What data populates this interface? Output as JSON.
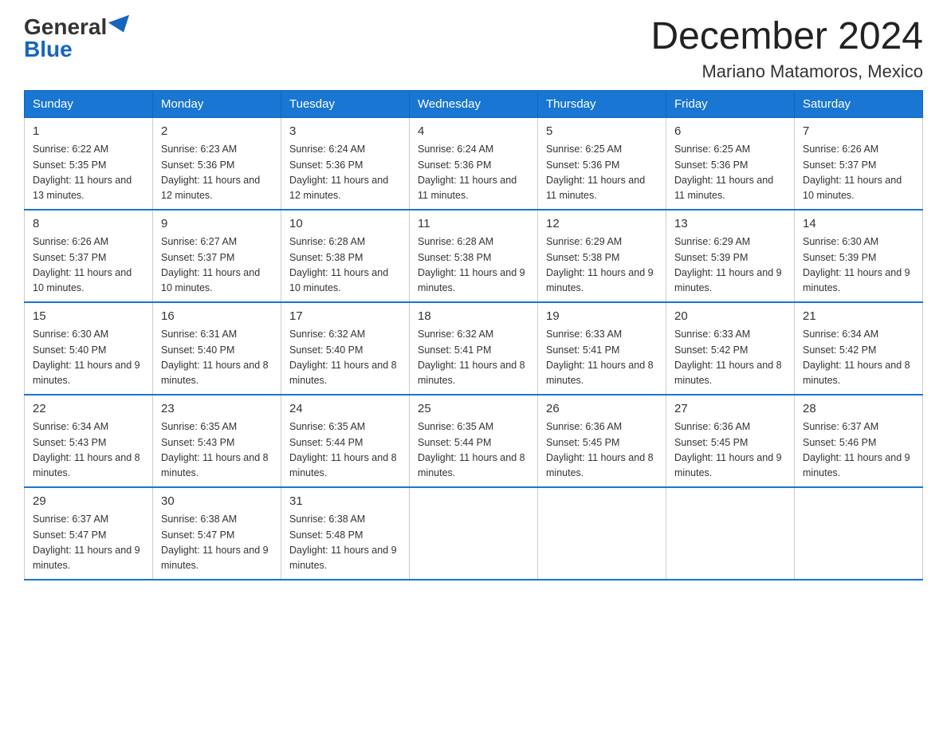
{
  "logo": {
    "general": "General",
    "blue": "Blue"
  },
  "title": {
    "month": "December 2024",
    "location": "Mariano Matamoros, Mexico"
  },
  "header_days": [
    "Sunday",
    "Monday",
    "Tuesday",
    "Wednesday",
    "Thursday",
    "Friday",
    "Saturday"
  ],
  "weeks": [
    [
      {
        "day": "1",
        "sunrise": "6:22 AM",
        "sunset": "5:35 PM",
        "daylight": "11 hours and 13 minutes."
      },
      {
        "day": "2",
        "sunrise": "6:23 AM",
        "sunset": "5:36 PM",
        "daylight": "11 hours and 12 minutes."
      },
      {
        "day": "3",
        "sunrise": "6:24 AM",
        "sunset": "5:36 PM",
        "daylight": "11 hours and 12 minutes."
      },
      {
        "day": "4",
        "sunrise": "6:24 AM",
        "sunset": "5:36 PM",
        "daylight": "11 hours and 11 minutes."
      },
      {
        "day": "5",
        "sunrise": "6:25 AM",
        "sunset": "5:36 PM",
        "daylight": "11 hours and 11 minutes."
      },
      {
        "day": "6",
        "sunrise": "6:25 AM",
        "sunset": "5:36 PM",
        "daylight": "11 hours and 11 minutes."
      },
      {
        "day": "7",
        "sunrise": "6:26 AM",
        "sunset": "5:37 PM",
        "daylight": "11 hours and 10 minutes."
      }
    ],
    [
      {
        "day": "8",
        "sunrise": "6:26 AM",
        "sunset": "5:37 PM",
        "daylight": "11 hours and 10 minutes."
      },
      {
        "day": "9",
        "sunrise": "6:27 AM",
        "sunset": "5:37 PM",
        "daylight": "11 hours and 10 minutes."
      },
      {
        "day": "10",
        "sunrise": "6:28 AM",
        "sunset": "5:38 PM",
        "daylight": "11 hours and 10 minutes."
      },
      {
        "day": "11",
        "sunrise": "6:28 AM",
        "sunset": "5:38 PM",
        "daylight": "11 hours and 9 minutes."
      },
      {
        "day": "12",
        "sunrise": "6:29 AM",
        "sunset": "5:38 PM",
        "daylight": "11 hours and 9 minutes."
      },
      {
        "day": "13",
        "sunrise": "6:29 AM",
        "sunset": "5:39 PM",
        "daylight": "11 hours and 9 minutes."
      },
      {
        "day": "14",
        "sunrise": "6:30 AM",
        "sunset": "5:39 PM",
        "daylight": "11 hours and 9 minutes."
      }
    ],
    [
      {
        "day": "15",
        "sunrise": "6:30 AM",
        "sunset": "5:40 PM",
        "daylight": "11 hours and 9 minutes."
      },
      {
        "day": "16",
        "sunrise": "6:31 AM",
        "sunset": "5:40 PM",
        "daylight": "11 hours and 8 minutes."
      },
      {
        "day": "17",
        "sunrise": "6:32 AM",
        "sunset": "5:40 PM",
        "daylight": "11 hours and 8 minutes."
      },
      {
        "day": "18",
        "sunrise": "6:32 AM",
        "sunset": "5:41 PM",
        "daylight": "11 hours and 8 minutes."
      },
      {
        "day": "19",
        "sunrise": "6:33 AM",
        "sunset": "5:41 PM",
        "daylight": "11 hours and 8 minutes."
      },
      {
        "day": "20",
        "sunrise": "6:33 AM",
        "sunset": "5:42 PM",
        "daylight": "11 hours and 8 minutes."
      },
      {
        "day": "21",
        "sunrise": "6:34 AM",
        "sunset": "5:42 PM",
        "daylight": "11 hours and 8 minutes."
      }
    ],
    [
      {
        "day": "22",
        "sunrise": "6:34 AM",
        "sunset": "5:43 PM",
        "daylight": "11 hours and 8 minutes."
      },
      {
        "day": "23",
        "sunrise": "6:35 AM",
        "sunset": "5:43 PM",
        "daylight": "11 hours and 8 minutes."
      },
      {
        "day": "24",
        "sunrise": "6:35 AM",
        "sunset": "5:44 PM",
        "daylight": "11 hours and 8 minutes."
      },
      {
        "day": "25",
        "sunrise": "6:35 AM",
        "sunset": "5:44 PM",
        "daylight": "11 hours and 8 minutes."
      },
      {
        "day": "26",
        "sunrise": "6:36 AM",
        "sunset": "5:45 PM",
        "daylight": "11 hours and 8 minutes."
      },
      {
        "day": "27",
        "sunrise": "6:36 AM",
        "sunset": "5:45 PM",
        "daylight": "11 hours and 9 minutes."
      },
      {
        "day": "28",
        "sunrise": "6:37 AM",
        "sunset": "5:46 PM",
        "daylight": "11 hours and 9 minutes."
      }
    ],
    [
      {
        "day": "29",
        "sunrise": "6:37 AM",
        "sunset": "5:47 PM",
        "daylight": "11 hours and 9 minutes."
      },
      {
        "day": "30",
        "sunrise": "6:38 AM",
        "sunset": "5:47 PM",
        "daylight": "11 hours and 9 minutes."
      },
      {
        "day": "31",
        "sunrise": "6:38 AM",
        "sunset": "5:48 PM",
        "daylight": "11 hours and 9 minutes."
      },
      {
        "day": "",
        "sunrise": "",
        "sunset": "",
        "daylight": ""
      },
      {
        "day": "",
        "sunrise": "",
        "sunset": "",
        "daylight": ""
      },
      {
        "day": "",
        "sunrise": "",
        "sunset": "",
        "daylight": ""
      },
      {
        "day": "",
        "sunrise": "",
        "sunset": "",
        "daylight": ""
      }
    ]
  ]
}
